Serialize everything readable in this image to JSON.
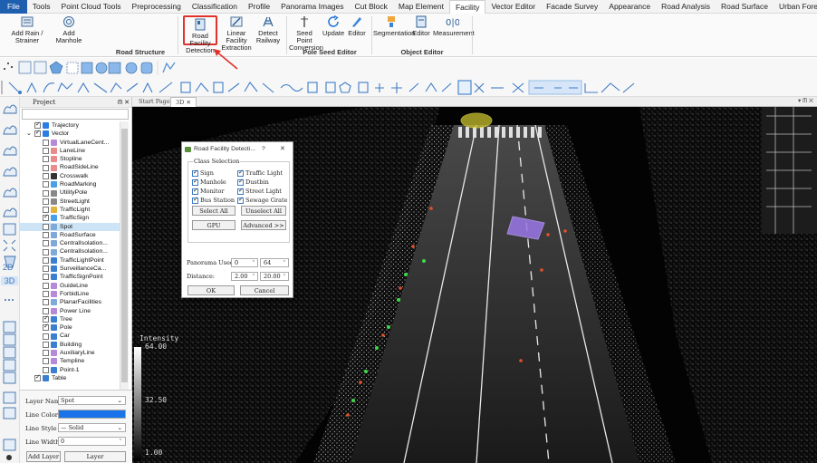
{
  "menu": [
    "File",
    "Tools",
    "Point Cloud Tools",
    "Preprocessing",
    "Classification",
    "Profile",
    "Panorama Images",
    "Cut Block",
    "Map Element",
    "Facility",
    "Vector Editor",
    "Facade Survey",
    "Appearance",
    "Road Analysis",
    "Road Surface",
    "Urban Forestry"
  ],
  "menu_active": "Facility",
  "ribbon": {
    "add_rain": "Add Rain / Strainer",
    "add_manhole": "Add Manhole",
    "road_facility": "Road Facility Detection",
    "linear_facility": "Linear Facility Extraction",
    "detect_railway": "Detect Railway",
    "group_road_structure": "Road Structure",
    "seed_point": "Seed Point Conversion",
    "update": "Update",
    "editor1": "Editor",
    "group_pole_seed": "Pole Seed Editor",
    "segmentation": "Segmentation",
    "editor2": "Editor",
    "measurement": "Measurement",
    "group_object": "Object Editor"
  },
  "left_labels": {
    "twod": "2D",
    "threed": "3D"
  },
  "project": {
    "title": "Project",
    "tree": [
      {
        "label": "Trajectory",
        "checked": true,
        "indent": 2,
        "color": "#2a7de1"
      },
      {
        "label": "Vector",
        "checked": true,
        "indent": 1,
        "color": "#2a7de1",
        "expand": "⌄"
      },
      {
        "label": "VirtualLaneCent...",
        "checked": false,
        "indent": 3,
        "color": "#b58ad9"
      },
      {
        "label": "LaneLine",
        "checked": false,
        "indent": 3,
        "color": "#e88b8b"
      },
      {
        "label": "Stopline",
        "checked": false,
        "indent": 3,
        "color": "#e88b8b"
      },
      {
        "label": "RoadSideLine",
        "checked": false,
        "indent": 3,
        "color": "#e88b8b"
      },
      {
        "label": "Crosswalk",
        "checked": false,
        "indent": 3,
        "color": "#333"
      },
      {
        "label": "RoadMarking",
        "checked": false,
        "indent": 3,
        "color": "#4aa0e8"
      },
      {
        "label": "UtilityPole",
        "checked": false,
        "indent": 3,
        "color": "#888"
      },
      {
        "label": "StreetLight",
        "checked": false,
        "indent": 3,
        "color": "#888"
      },
      {
        "label": "TrafficLight",
        "checked": false,
        "indent": 3,
        "color": "#e3b23c"
      },
      {
        "label": "TrafficSign",
        "checked": true,
        "indent": 3,
        "color": "#4aa0e8"
      },
      {
        "label": "Spot",
        "checked": false,
        "indent": 3,
        "color": "#7fa9d8",
        "selected": true
      },
      {
        "label": "RoadSurface",
        "checked": false,
        "indent": 3,
        "color": "#7fa9d8"
      },
      {
        "label": "CentralIsolation...",
        "checked": false,
        "indent": 3,
        "color": "#7fa9d8"
      },
      {
        "label": "CentralIsolation...",
        "checked": false,
        "indent": 3,
        "color": "#7fa9d8"
      },
      {
        "label": "TrafficLightPoint",
        "checked": false,
        "indent": 3,
        "color": "#3a7fd0"
      },
      {
        "label": "SurveillanceCa...",
        "checked": false,
        "indent": 3,
        "color": "#3a7fd0"
      },
      {
        "label": "TrafficSignPoint",
        "checked": false,
        "indent": 3,
        "color": "#3a7fd0"
      },
      {
        "label": "GuideLine",
        "checked": false,
        "indent": 3,
        "color": "#b58ad9"
      },
      {
        "label": "ForbidLine",
        "checked": false,
        "indent": 3,
        "color": "#b58ad9"
      },
      {
        "label": "PlanarFacilities",
        "checked": false,
        "indent": 3,
        "color": "#7fa9d8"
      },
      {
        "label": "Power Line",
        "checked": false,
        "indent": 3,
        "color": "#b58ad9"
      },
      {
        "label": "Tree",
        "checked": true,
        "indent": 3,
        "color": "#3a7fd0"
      },
      {
        "label": "Pole",
        "checked": true,
        "indent": 3,
        "color": "#3a7fd0"
      },
      {
        "label": "Car",
        "checked": false,
        "indent": 3,
        "color": "#3a7fd0"
      },
      {
        "label": "Building",
        "checked": false,
        "indent": 3,
        "color": "#3a7fd0"
      },
      {
        "label": "AuxiliaryLine",
        "checked": false,
        "indent": 3,
        "color": "#b58ad9"
      },
      {
        "label": "Templine",
        "checked": false,
        "indent": 3,
        "color": "#b58ad9"
      },
      {
        "label": "Point-1",
        "checked": false,
        "indent": 3,
        "color": "#3a7fd0"
      },
      {
        "label": "Table",
        "checked": true,
        "indent": 2,
        "color": "#3a7fd0"
      }
    ]
  },
  "layer_props": {
    "name_label": "Layer Name",
    "name_value": "Spot",
    "color_label": "Line Color",
    "line_color": "#1a73e8",
    "style_label": "Line Style",
    "style_value": "— Solid",
    "width_label": "Line Width",
    "width_value": "0",
    "add_layer": "Add Layer",
    "layer_config": "Layer Configuration"
  },
  "view": {
    "tab1": "Start Page",
    "tab2": "3D",
    "legend_title": "Intensity",
    "legend_max": "64.00",
    "legend_mid": "32.50",
    "legend_min": "1.00"
  },
  "dialog": {
    "title": "Road Facility Detecti...",
    "help": "?",
    "close": "✕",
    "group": "Class Selection",
    "classes": [
      {
        "label": "Sign",
        "checked": true
      },
      {
        "label": "Traffic Light",
        "checked": true
      },
      {
        "label": "Manhole",
        "checked": true
      },
      {
        "label": "Dustbin",
        "checked": true
      },
      {
        "label": "Monitor",
        "checked": true
      },
      {
        "label": "Street Light",
        "checked": true
      },
      {
        "label": "Bus Station",
        "checked": true
      },
      {
        "label": "Sewage Grate",
        "checked": true
      }
    ],
    "select_all": "Select All",
    "unselect_all": "Unselect All",
    "gpu": "GPU",
    "advanced": "Advanced >>",
    "panorama_label": "Panorama Used:",
    "pano_from": "0",
    "pano_to": "64",
    "distance_label": "Distance:",
    "dist_from": "2.00",
    "dist_to": "20.00",
    "ok": "OK",
    "cancel": "Cancel"
  }
}
